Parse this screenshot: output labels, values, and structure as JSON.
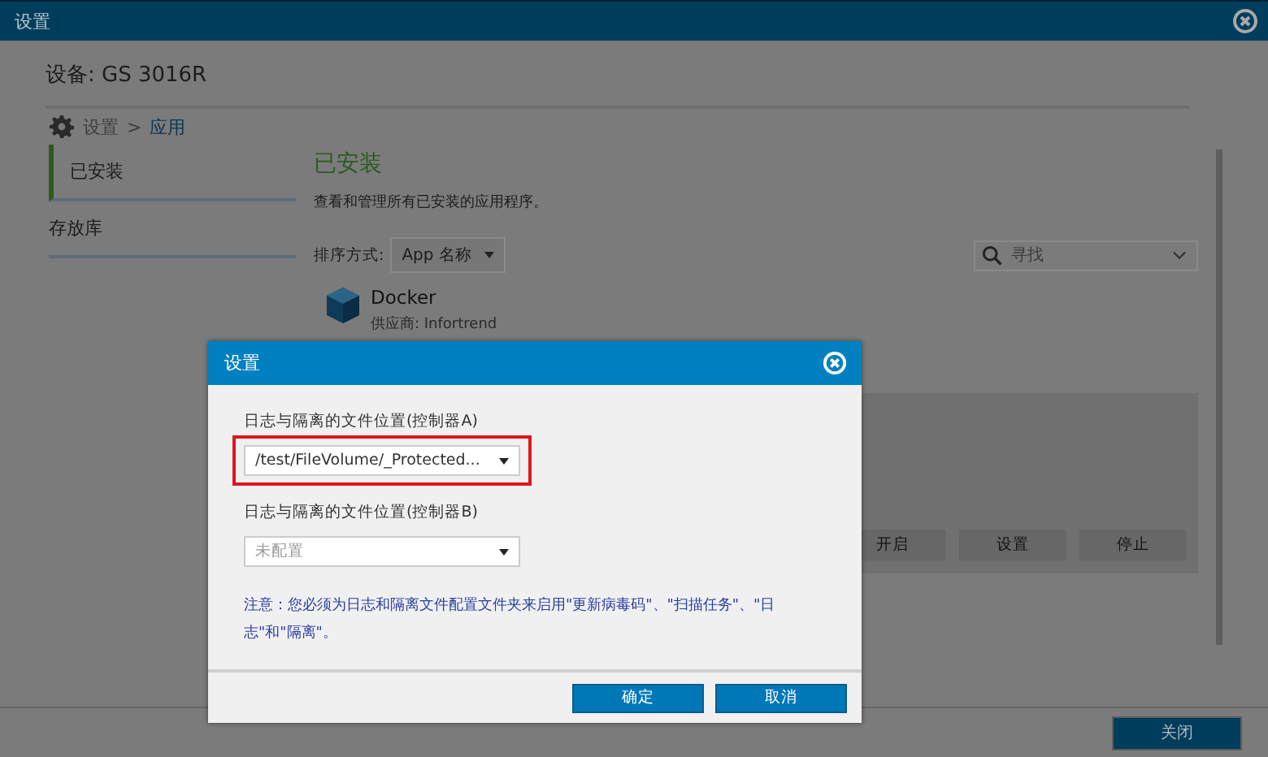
{
  "window": {
    "title": "设置"
  },
  "device_title": "设备: GS 3016R",
  "breadcrumb": [
    {
      "label": "设置",
      "selected": false
    },
    {
      "label": "应用",
      "selected": true
    }
  ],
  "breadcrumb_separator": ">",
  "sidebar": {
    "items": [
      {
        "label": "已安装",
        "selected": true
      },
      {
        "label": "存放库",
        "selected": false
      }
    ]
  },
  "content": {
    "heading": "已安装",
    "description": "查看和管理所有已安装的应用程序。",
    "sort_label": "排序方式:",
    "sort_value": "App 名称",
    "search": {
      "placeholder": "寻找"
    },
    "apps": [
      {
        "name": "Docker",
        "vendor": "供应商: Infortrend",
        "buttons": [
          "开启",
          "设置",
          "停止"
        ]
      }
    ]
  },
  "footer_button": "关闭",
  "dialog": {
    "title": "设置",
    "fields": [
      {
        "label": "日志与隔离的文件位置(控制器A)",
        "value": "/test/FileVolume/_Protected...",
        "highlighted": true
      },
      {
        "label": "日志与隔离的文件位置(控制器B)",
        "placeholder": "未配置",
        "highlighted": false
      }
    ],
    "note": "注意：您必须为日志和隔离文件配置文件夹来启用\"更新病毒码\"、\"扫描任务\"、\"日志\"和\"隔离\"。",
    "buttons": [
      "确定",
      "取消"
    ]
  }
}
